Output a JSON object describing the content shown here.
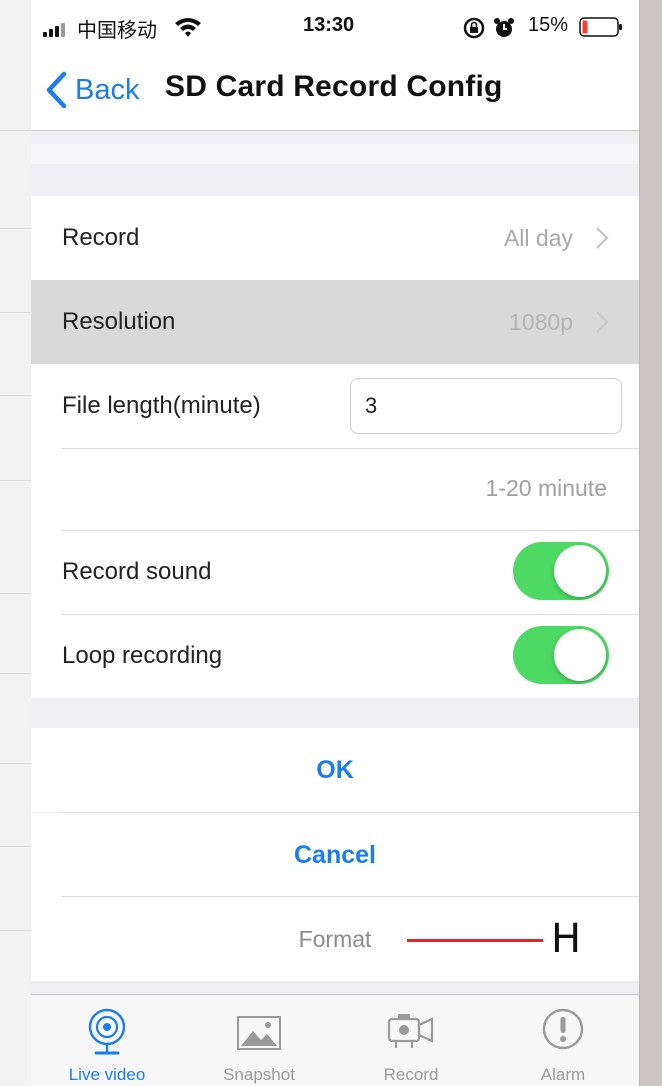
{
  "status_bar": {
    "carrier": "中国移动",
    "time": "13:30",
    "battery_percent": "15%",
    "battery_level": 0.15
  },
  "nav": {
    "back_label": "Back",
    "title": "SD Card Record Config"
  },
  "settings": {
    "record": {
      "label": "Record",
      "value": "All day"
    },
    "resolution": {
      "label": "Resolution",
      "value": "1080p"
    },
    "file_length": {
      "label": "File length(minute)",
      "value": "3",
      "hint": "1-20 minute"
    },
    "record_sound": {
      "label": "Record sound",
      "on": true
    },
    "loop_recording": {
      "label": "Loop recording",
      "on": true
    }
  },
  "actions": {
    "ok": "OK",
    "cancel": "Cancel",
    "format": "Format"
  },
  "annotation": {
    "letter": "H",
    "color": "#e0242b"
  },
  "tabs": [
    {
      "label": "Live video",
      "icon": "live-video-icon",
      "active": true
    },
    {
      "label": "Snapshot",
      "icon": "snapshot-icon",
      "active": false
    },
    {
      "label": "Record",
      "icon": "record-camera-icon",
      "active": false
    },
    {
      "label": "Alarm",
      "icon": "alarm-icon",
      "active": false
    }
  ],
  "colors": {
    "accent": "#1a7cf2",
    "toggle_on": "#4cd964",
    "selected_row": "#d9d9d9",
    "group_background": "#efeff4"
  }
}
